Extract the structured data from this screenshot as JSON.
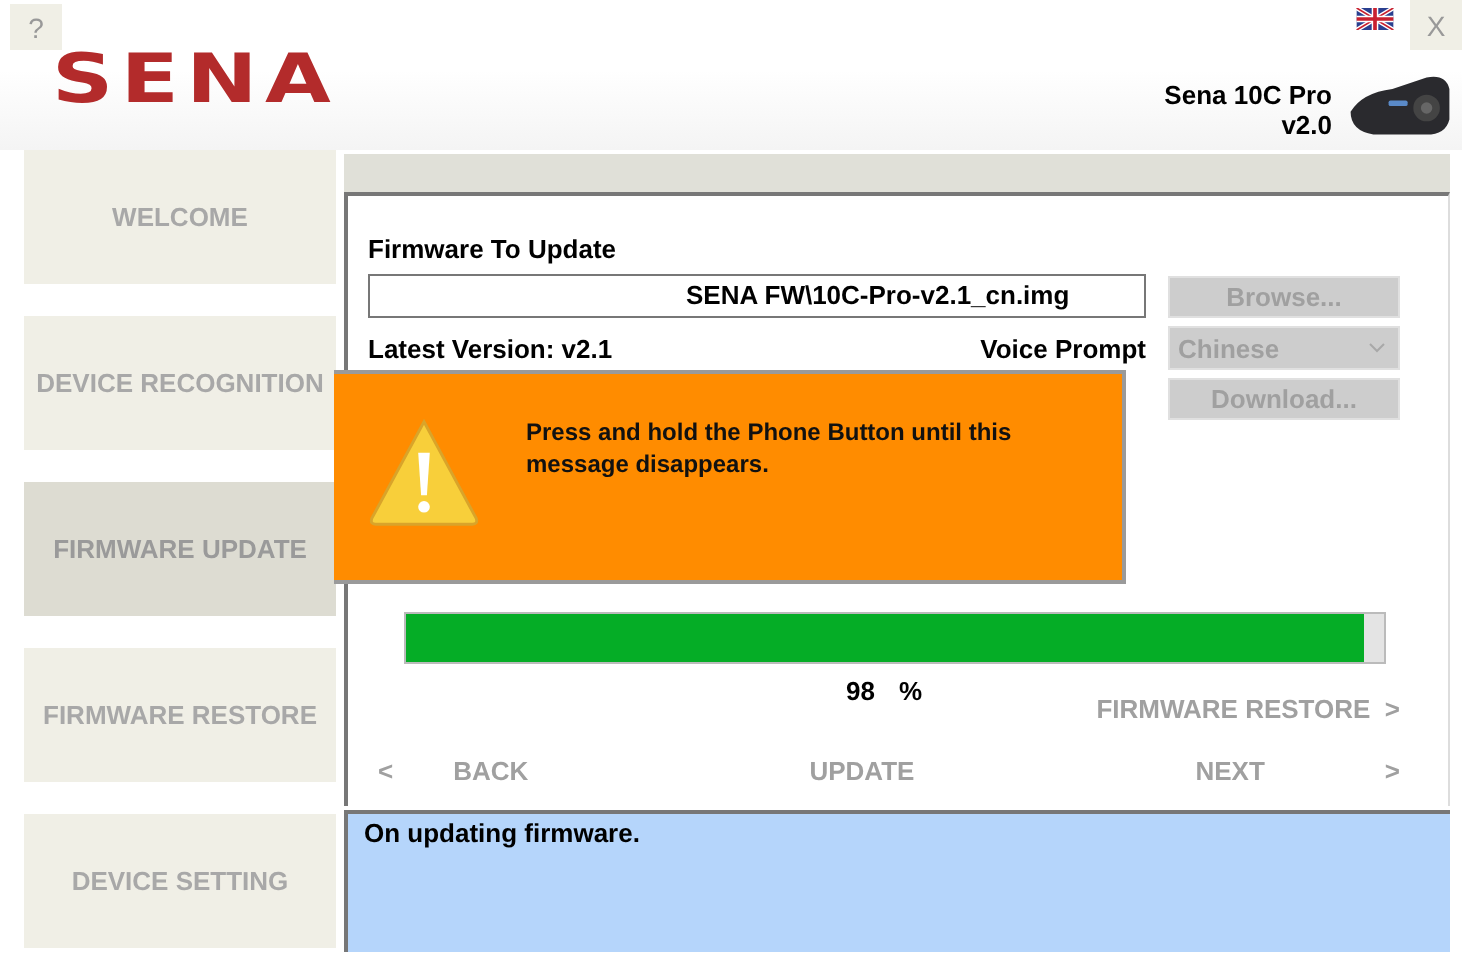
{
  "window": {
    "help_button": "?",
    "close_button": "X"
  },
  "header": {
    "logo": "SENA",
    "product_name": "Sena 10C Pro",
    "product_version": "v2.0"
  },
  "sidebar": {
    "items": [
      {
        "label": "WELCOME",
        "selected": false
      },
      {
        "label": "DEVICE RECOGNITION",
        "selected": false
      },
      {
        "label": "FIRMWARE UPDATE",
        "selected": true
      },
      {
        "label": "FIRMWARE RESTORE",
        "selected": false
      },
      {
        "label": "DEVICE SETTING",
        "selected": false
      }
    ]
  },
  "firmware": {
    "label": "Firmware To Update",
    "file_value": "SENA FW\\10C-Pro-v2.1_cn.img",
    "browse_button": {
      "label": "Browse...",
      "disabled": true
    },
    "latest_version": "Latest Version: v2.1",
    "voice_prompt_label": "Voice Prompt",
    "voice_prompt": {
      "value": "Chinese",
      "disabled": true
    },
    "download_button": {
      "label": "Download...",
      "disabled": true
    }
  },
  "alert": {
    "message": "Press and hold the Phone Button until this message disappears."
  },
  "progress": {
    "level": 0.98,
    "value": "98",
    "unit": "%"
  },
  "restore_link": {
    "label": "FIRMWARE RESTORE",
    "arrow": ">",
    "disabled": true
  },
  "navigation": {
    "back_arrow": "<",
    "back": {
      "label": "BACK",
      "disabled": true
    },
    "update": {
      "label": "UPDATE",
      "disabled": true
    },
    "next": {
      "label": "NEXT",
      "disabled": true
    },
    "next_arrow": ">"
  },
  "status_bar": {
    "message": "On updating firmware."
  }
}
